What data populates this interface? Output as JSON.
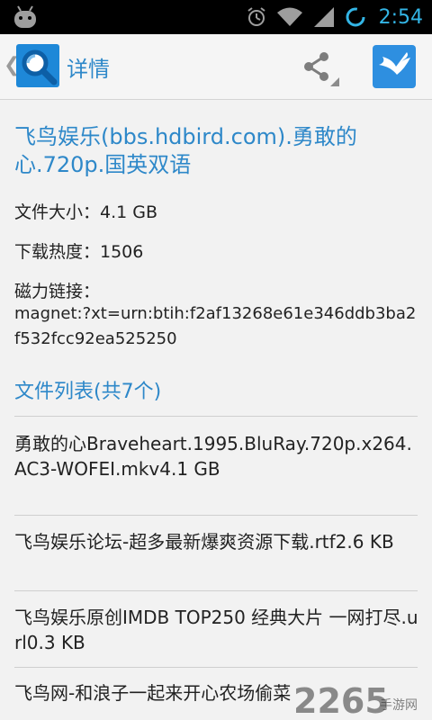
{
  "status_bar": {
    "time": "2:54",
    "icons": [
      "android-icon",
      "alarm-icon",
      "wifi-icon",
      "signal-icon",
      "sync-icon"
    ]
  },
  "action_bar": {
    "title": "详情",
    "icons": [
      "back-chevron-icon",
      "search-app-logo-icon",
      "share-icon",
      "bird-app-icon"
    ]
  },
  "detail": {
    "title": "飞鸟娱乐(bbs.hdbird.com).勇敢的心.720p.国英双语",
    "file_size": "文件大小：4.1 GB",
    "download_heat": "下载热度：1506",
    "magnet_label": "磁力链接：",
    "magnet_value": "magnet:?xt=urn:btih:f2af13268e61e346ddb3ba2f532fcc92ea525250"
  },
  "files": {
    "heading": "文件列表(共7个)",
    "items": [
      "勇敢的心Braveheart.1995.BluRay.720p.x264.AC3-WOFEI.mkv4.1 GB",
      "飞鸟娱乐论坛-超多最新爆爽资源下载.rtf2.6 KB",
      "飞鸟娱乐原创IMDB TOP250 经典大片 一网打尽.url0.3 KB",
      "飞鸟网-和浪子一起来开心农场偷菜"
    ]
  },
  "watermark": {
    "text": "2265",
    "sub": "手游网"
  },
  "colors": {
    "accent": "#2e88c9",
    "status_bar": "#000000",
    "status_icons": "#33b5e5",
    "background": "#f2f2f2"
  }
}
